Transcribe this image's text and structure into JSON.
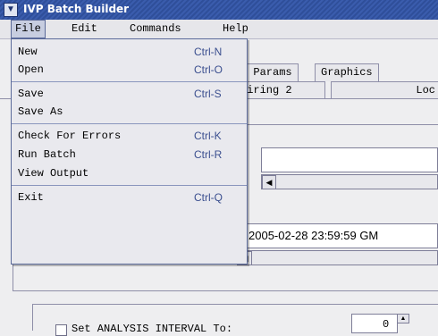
{
  "window": {
    "title": "IVP Batch Builder"
  },
  "menubar": {
    "items": [
      "File",
      "Edit",
      "Commands",
      "Help"
    ]
  },
  "file_menu": {
    "items": [
      {
        "label": "New",
        "shortcut": "Ctrl-N"
      },
      {
        "label": "Open",
        "shortcut": "Ctrl-O"
      },
      {
        "label": "Save",
        "shortcut": "Ctrl-S"
      },
      {
        "label": "Save As",
        "shortcut": ""
      },
      {
        "label": "Check For Errors",
        "shortcut": "Ctrl-K"
      },
      {
        "label": "Run Batch",
        "shortcut": "Ctrl-R"
      },
      {
        "label": "View Output",
        "shortcut": ""
      },
      {
        "label": "Exit",
        "shortcut": "Ctrl-Q"
      }
    ]
  },
  "tabs": {
    "row1": [
      "t Params",
      "Graphics"
    ],
    "row2": [
      "airing 2",
      "Loc"
    ]
  },
  "fields": {
    "date_value": "2005-02-28 23:59:59 GM",
    "interval_label": "Set ANALYSIS INTERVAL To:",
    "interval_value": "0"
  },
  "colors": {
    "titlebar": "#2f4f9a",
    "menu_accent": "#3b4f8f",
    "menu_bg": "#e9e9ee"
  }
}
